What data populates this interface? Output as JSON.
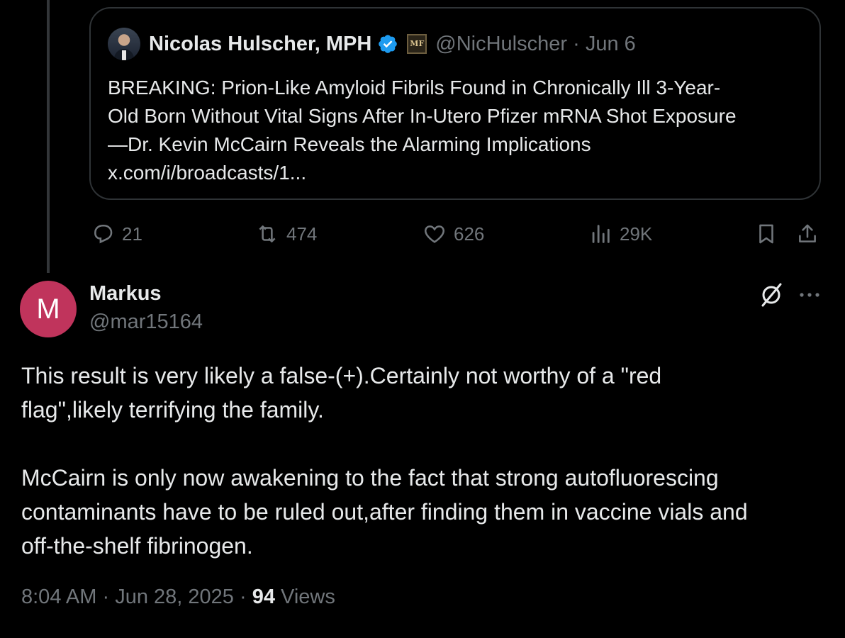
{
  "colors": {
    "background": "#000000",
    "text_primary": "#e7e9ea",
    "text_secondary": "#71767b",
    "verified_blue": "#1d9bf0",
    "avatar_markus": "#c0345c",
    "border": "#2f3336"
  },
  "quoted_post": {
    "author_name": "Nicolas Hulscher, MPH",
    "verified_icon": "verified-badge-icon",
    "affiliate_badge_text": "MF",
    "handle": "@NicHulscher",
    "separator": "·",
    "date": "Jun 6",
    "text_lines": [
      "BREAKING: Prion-Like Amyloid Fibrils Found in Chronically Ill 3-Year-",
      "Old Born Without Vital Signs After In-Utero Pfizer mRNA Shot Exposure",
      "—Dr. Kevin McCairn Reveals the Alarming Implications",
      "x.com/i/broadcasts/1..."
    ],
    "actions": {
      "replies": "21",
      "reposts": "474",
      "likes": "626",
      "views": "29K"
    }
  },
  "reply_post": {
    "avatar_letter": "M",
    "author_name": "Markus",
    "handle": "@mar15164",
    "paragraph_1_lines": [
      "This result is very likely a false-(+).Certainly not worthy of a \"red",
      "flag\",likely terrifying the family."
    ],
    "paragraph_2_lines": [
      "McCairn is only now awakening to the fact that strong autofluorescing",
      "contaminants have to be ruled out,after finding them in vaccine vials and",
      "off-the-shelf fibrinogen."
    ],
    "time": "8:04 AM",
    "dot": "·",
    "date": "Jun 28, 2025",
    "views_count": "94",
    "views_label": "Views"
  }
}
